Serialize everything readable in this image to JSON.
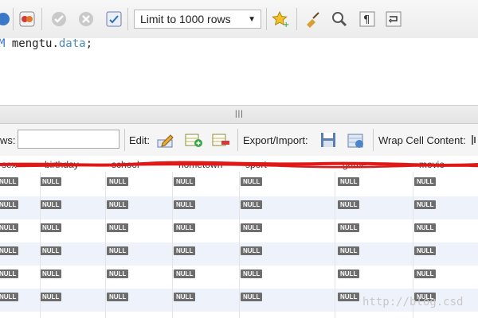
{
  "toolbar": {
    "limit_rows": "Limit to 1000 rows"
  },
  "editor": {
    "code_kw": "M",
    "code_rest_a": " mengtu.",
    "code_table": "data",
    "code_end": ";"
  },
  "results_toolbar": {
    "filter_label": "ws:",
    "edit_label": "Edit:",
    "export_label": "Export/Import:",
    "wrap_label": "Wrap Cell Content:"
  },
  "grid": {
    "columns": [
      "sex",
      "birthday",
      "school",
      "hometown",
      "sport",
      "game",
      "movie"
    ],
    "null_label": "NULL"
  },
  "watermark": "http://blog.csd"
}
